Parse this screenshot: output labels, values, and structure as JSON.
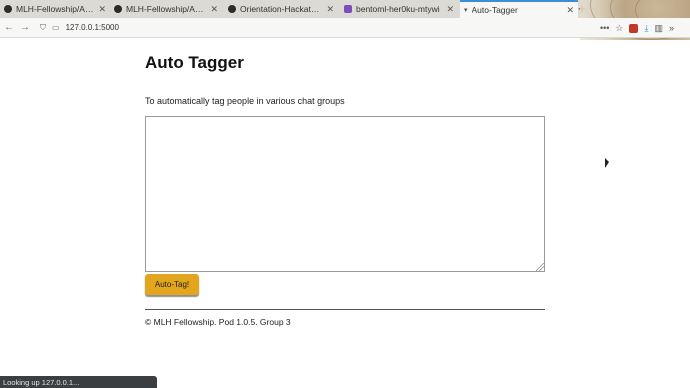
{
  "tabs": [
    {
      "label": "MLH-Fellowship/Auto-T",
      "color": "#2b2b2b"
    },
    {
      "label": "MLH-Fellowship/Auto-T",
      "color": "#2b2b2b"
    },
    {
      "label": "Orientation-Hackathon",
      "color": "#2b2b2b"
    },
    {
      "label": "bentoml-her0ku-mtywi",
      "color": "#7c4dbb"
    },
    {
      "label": "Auto-Tagger",
      "color": "#555555"
    }
  ],
  "toolbar": {
    "url": "127.0.0.1:5000",
    "back_icon": "back-icon",
    "forward_icon": "forward-icon"
  },
  "page": {
    "title": "Auto Tagger",
    "description": "To automatically tag people in various chat groups",
    "textarea_value": "",
    "button_label": "Auto-Tag!",
    "footer": "© MLH Fellowship. Pod 1.0.5. Group 3"
  },
  "status_bar": "Looking up 127.0.0.1...",
  "colors": {
    "button": "#e3a51d",
    "active_tab_accent": "#3a8fd8"
  }
}
